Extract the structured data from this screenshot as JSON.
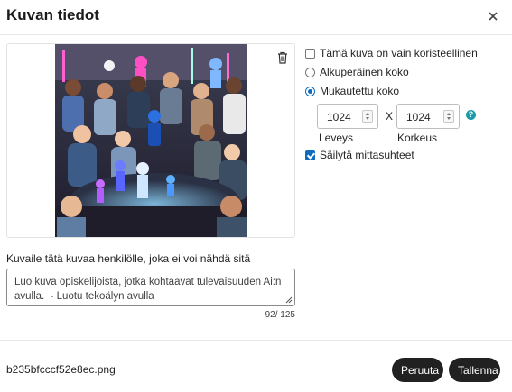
{
  "dialog": {
    "title": "Kuvan tiedot",
    "close_icon": "close-icon"
  },
  "options": {
    "decorative_label": "Tämä kuva on vain koristeellinen",
    "decorative_checked": false,
    "original_size_label": "Alkuperäinen koko",
    "custom_size_label": "Mukautettu koko",
    "selected_size": "custom",
    "width_value": "1024",
    "height_value": "1024",
    "width_label": "Leveys",
    "height_label": "Korkeus",
    "times": "X",
    "help_icon": "?",
    "keep_ratio_label": "Säilytä mittasuhteet",
    "keep_ratio_checked": true
  },
  "alt": {
    "label": "Kuvaile tätä kuvaa henkilölle, joka ei voi nähdä sitä",
    "value": "Luo kuva opiskelijoista, jotka kohtaavat tulevaisuuden Ai:n avulla.  - Luotu tekoälyn avulla",
    "counter": "92/ 125"
  },
  "footer": {
    "filename": "b235bfcccf52e8ec.png",
    "cancel_label": "Peruuta",
    "save_label": "Tallenna"
  },
  "colors": {
    "accent": "#0f6cbd",
    "button_bg": "#212121",
    "help": "#1a9ba8"
  }
}
